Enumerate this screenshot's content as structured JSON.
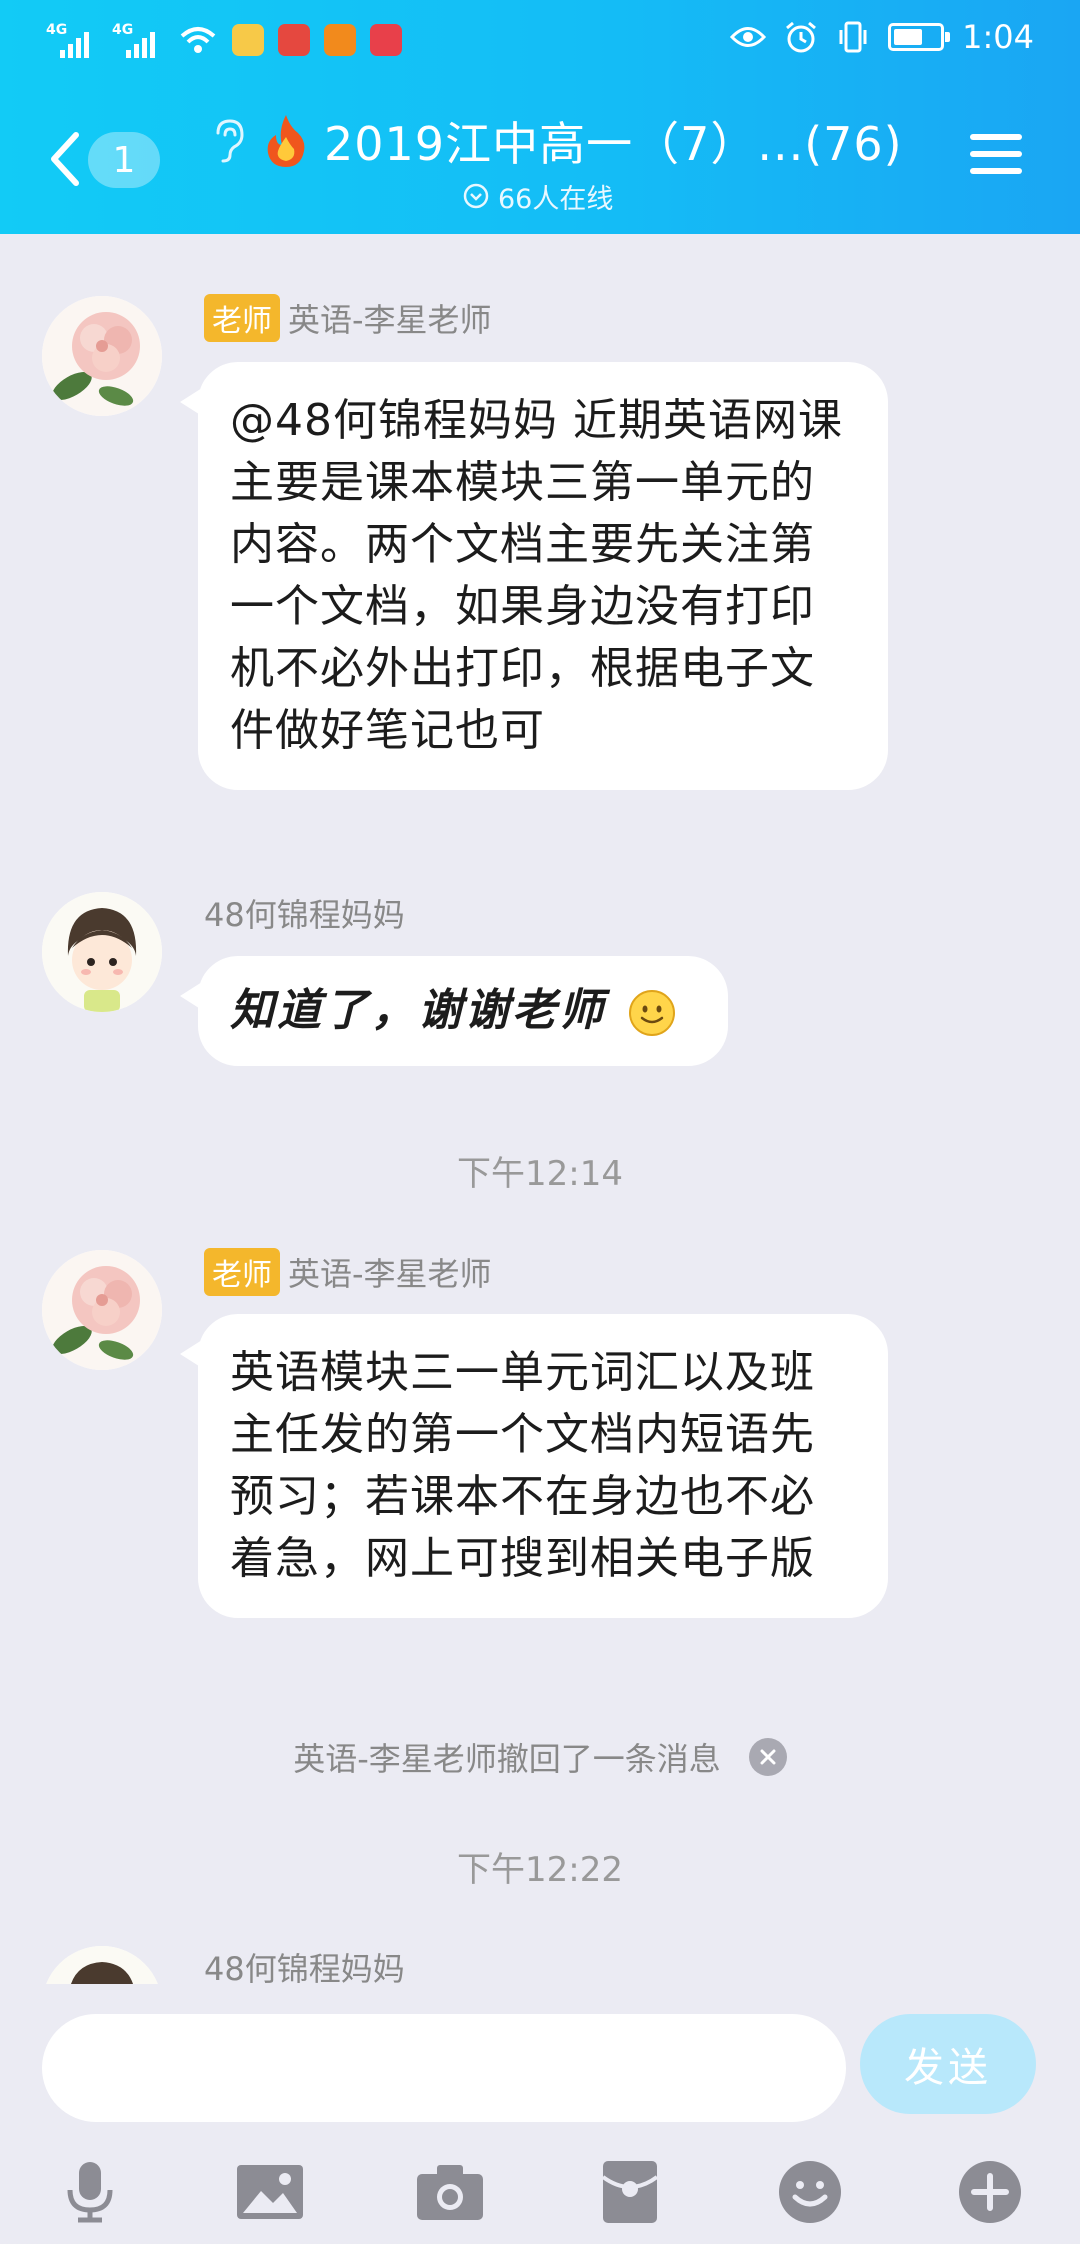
{
  "status_bar": {
    "network_1": "4G",
    "network_2": "4G",
    "time": "1:04"
  },
  "header": {
    "unread_count": "1",
    "title": "2019江中高一（7）...(76)",
    "online": "66人在线"
  },
  "messages": [
    {
      "role_tag": "老师",
      "sender": "英语-李星老师",
      "text": "@48何锦程妈妈 近期英语网课主要是课本模块三第一单元的内容。两个文档主要先关注第一个文档，如果身边没有打印机不必外出打印，根据电子文件做好笔记也可"
    },
    {
      "sender": "48何锦程妈妈",
      "text": "知道了，谢谢老师"
    },
    {
      "timestamp": "下午12:14"
    },
    {
      "role_tag": "老师",
      "sender": "英语-李星老师",
      "text": "英语模块三一单元词汇以及班主任发的第一个文档内短语先预习；若课本不在身边也不必着急，网上可搜到相关电子版"
    },
    {
      "system": "英语-李星老师撤回了一条消息"
    },
    {
      "timestamp": "下午12:22"
    },
    {
      "sender": "48何锦程妈妈"
    }
  ],
  "input": {
    "placeholder": "",
    "send_label": "发送"
  },
  "toolbar": [
    "mic-icon",
    "image-icon",
    "camera-icon",
    "red-packet-icon",
    "emoji-icon",
    "plus-icon"
  ],
  "colors": {
    "header_start": "#12cbf6",
    "header_end": "#1aa6f3",
    "background": "#ebebf3",
    "teacher_tag": "#f4b72c",
    "send_disabled": "#b8e8fb"
  }
}
